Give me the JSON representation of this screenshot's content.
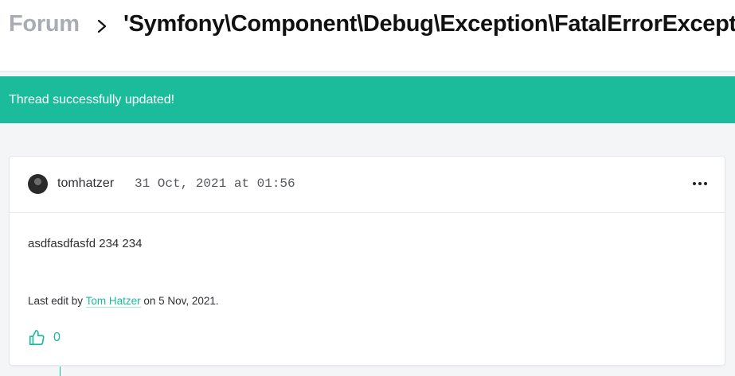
{
  "breadcrumb": {
    "root": "Forum",
    "title": "'Symfony\\Component\\Debug\\Exception\\FatalErrorException'"
  },
  "flash": {
    "message": "Thread successfully updated!"
  },
  "post": {
    "author": "tomhatzer",
    "timestamp": "31 Oct, 2021 at 01:56",
    "body": "asdfasdfasfd 234 234",
    "edit_prefix": "Last edit by",
    "editor": "Tom Hatzer",
    "edit_suffix": "on 5 Nov, 2021.",
    "likes": "0"
  },
  "colors": {
    "accent": "#1abc9c",
    "crumb_root": "#a9acb2",
    "text": "#2d2f33"
  },
  "icons": {
    "separator": "chevron-right-icon",
    "menu": "more-horizontal-icon",
    "like": "thumbs-up-icon"
  }
}
